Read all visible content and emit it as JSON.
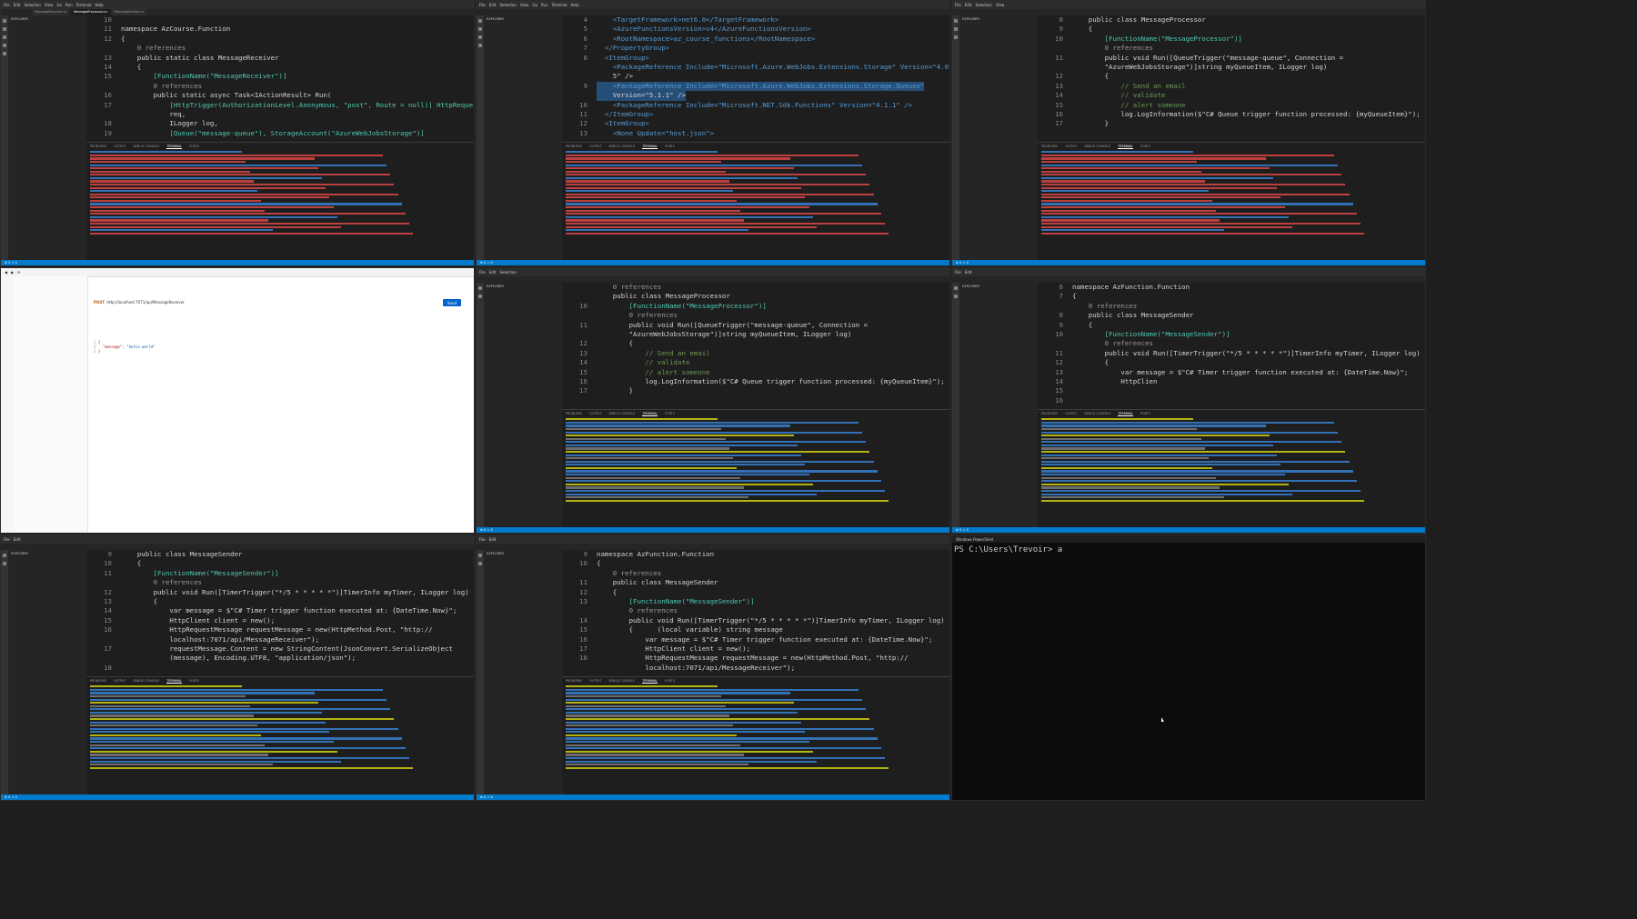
{
  "common": {
    "menu": [
      "File",
      "Edit",
      "Selection",
      "View",
      "Go",
      "Run",
      "Terminal",
      "Help"
    ],
    "explorer_title": "EXPLORER",
    "terminal_tabs": [
      "PROBLEMS",
      "OUTPUT",
      "DEBUG CONSOLE",
      "TERMINAL",
      "PORTS"
    ],
    "status_left": "⊗ 0 ⚠ 0"
  },
  "pane1": {
    "tabs": [
      "MessageReceiver.cs",
      "MessageProcessor.cs",
      "MessageSender.cs"
    ],
    "lines": [
      {
        "n": "10",
        "t": ""
      },
      {
        "n": "11",
        "t": "namespace AzCourse.Function"
      },
      {
        "n": "12",
        "t": "{"
      },
      {
        "n": "",
        "t": "    0 references"
      },
      {
        "n": "13",
        "t": "    public static class MessageReceiver"
      },
      {
        "n": "14",
        "t": "    {"
      },
      {
        "n": "15",
        "t": "        [FunctionName(\"MessageReceiver\")]"
      },
      {
        "n": "",
        "t": "        0 references"
      },
      {
        "n": "16",
        "t": "        public static async Task<IActionResult> Run("
      },
      {
        "n": "17",
        "t": "            [HttpTrigger(AuthorizationLevel.Anonymous, \"post\", Route = null)] HttpRequest"
      },
      {
        "n": "",
        "t": "            req,"
      },
      {
        "n": "18",
        "t": "            ILogger log,"
      },
      {
        "n": "19",
        "t": "            [Queue(\"message-queue\"), StorageAccount(\"AzureWebJobsStorage\")]"
      }
    ]
  },
  "pane2": {
    "lines": [
      {
        "n": "4",
        "t": "    <TargetFramework>net6.0</TargetFramework>"
      },
      {
        "n": "5",
        "t": "    <AzureFunctionsVersion>v4</AzureFunctionsVersion>"
      },
      {
        "n": "6",
        "t": "    <RootNamespace>az_course_functions</RootNamespace>"
      },
      {
        "n": "7",
        "t": "  </PropertyGroup>"
      },
      {
        "n": "8",
        "t": "  <ItemGroup>"
      },
      {
        "n": "",
        "t": "    <PackageReference Include=\"Microsoft.Azure.WebJobs.Extensions.Storage\" Version=\"4.0."
      },
      {
        "n": "",
        "t": "    5\" />"
      },
      {
        "n": "9",
        "t": "    <PackageReference Include=\"Microsoft.Azure.WebJobs.Extensions.Storage.Queues\""
      },
      {
        "n": "",
        "t": "    Version=\"5.1.1\" />"
      },
      {
        "n": "10",
        "t": "    <PackageReference Include=\"Microsoft.NET.Sdk.Functions\" Version=\"4.1.1\" />"
      },
      {
        "n": "11",
        "t": "  </ItemGroup>"
      },
      {
        "n": "12",
        "t": "  <ItemGroup>"
      },
      {
        "n": "13",
        "t": "    <None Update=\"host.json\">"
      }
    ]
  },
  "pane3": {
    "lines": [
      {
        "n": "8",
        "t": "    public class MessageProcessor"
      },
      {
        "n": "9",
        "t": "    {"
      },
      {
        "n": "10",
        "t": "        [FunctionName(\"MessageProcessor\")]"
      },
      {
        "n": "",
        "t": "        0 references"
      },
      {
        "n": "11",
        "t": "        public void Run([QueueTrigger(\"message-queue\", Connection ="
      },
      {
        "n": "",
        "t": "        \"AzureWebJobsStorage\")]string myQueueItem, ILogger log)"
      },
      {
        "n": "12",
        "t": "        {"
      },
      {
        "n": "13",
        "t": "            // Send an email"
      },
      {
        "n": "14",
        "t": "            // validate"
      },
      {
        "n": "15",
        "t": "            // alert someone"
      },
      {
        "n": "16",
        "t": "            log.LogInformation($\"C# Queue trigger function processed: {myQueueItem}\");"
      },
      {
        "n": "17",
        "t": "        }"
      }
    ]
  },
  "pane4": {
    "url": "http://localhost:7071/api/MessageReceiver",
    "method": "POST",
    "send": "Send",
    "body_line1": "{",
    "body_key": "\"message\"",
    "body_value": "\"hello world\"",
    "body_line3": "}"
  },
  "pane5": {
    "lines": [
      {
        "n": "",
        "t": "    0 references"
      },
      {
        "n": "",
        "t": "    public class MessageProcessor"
      },
      {
        "n": "",
        "t": ""
      },
      {
        "n": "10",
        "t": "        [FunctionName(\"MessageProcessor\")]"
      },
      {
        "n": "",
        "t": "        0 references"
      },
      {
        "n": "11",
        "t": "        public void Run([QueueTrigger(\"message-queue\", Connection ="
      },
      {
        "n": "",
        "t": "        \"AzureWebJobsStorage\")]string myQueueItem, ILogger log)"
      },
      {
        "n": "12",
        "t": "        {"
      },
      {
        "n": "13",
        "t": "            // Send an email"
      },
      {
        "n": "14",
        "t": "            // validate"
      },
      {
        "n": "15",
        "t": "            // alert someone"
      },
      {
        "n": "16",
        "t": "            log.LogInformation($\"C# Queue trigger function processed: {myQueueItem}\");"
      },
      {
        "n": "17",
        "t": "        }"
      }
    ]
  },
  "pane6": {
    "lines": [
      {
        "n": "6",
        "t": "namespace AzFunction.Function"
      },
      {
        "n": "7",
        "t": "{"
      },
      {
        "n": "",
        "t": "    0 references"
      },
      {
        "n": "8",
        "t": "    public class MessageSender"
      },
      {
        "n": "9",
        "t": "    {"
      },
      {
        "n": "10",
        "t": "        [FunctionName(\"MessageSender\")]"
      },
      {
        "n": "",
        "t": "        0 references"
      },
      {
        "n": "11",
        "t": "        public void Run([TimerTrigger(\"*/5 * * * * *\")]TimerInfo myTimer, ILogger log)"
      },
      {
        "n": "12",
        "t": "        {"
      },
      {
        "n": "13",
        "t": "            var message = $\"C# Timer trigger function executed at: {DateTime.Now}\";"
      },
      {
        "n": "14",
        "t": "            HttpClien"
      },
      {
        "n": "15",
        "t": ""
      },
      {
        "n": "16",
        "t": ""
      }
    ]
  },
  "pane7": {
    "lines": [
      {
        "n": "9",
        "t": "    public class MessageSender"
      },
      {
        "n": "10",
        "t": "    {"
      },
      {
        "n": "11",
        "t": "        [FunctionName(\"MessageSender\")]"
      },
      {
        "n": "",
        "t": "        0 references"
      },
      {
        "n": "12",
        "t": "        public void Run([TimerTrigger(\"*/5 * * * * *\")]TimerInfo myTimer, ILogger log)"
      },
      {
        "n": "13",
        "t": "        {"
      },
      {
        "n": "14",
        "t": "            var message = $\"C# Timer trigger function executed at: {DateTime.Now}\";"
      },
      {
        "n": "15",
        "t": "            HttpClient client = new();"
      },
      {
        "n": "16",
        "t": "            HttpRequestMessage requestMessage = new(HttpMethod.Post, \"http://"
      },
      {
        "n": "",
        "t": "            localhost:7071/api/MessageReceiver\");"
      },
      {
        "n": "17",
        "t": "            requestMessage.Content = new StringContent(JsonConvert.SerializeObject"
      },
      {
        "n": "",
        "t": "            (message), Encoding.UTF8, \"application/json\");"
      },
      {
        "n": "18",
        "t": ""
      }
    ]
  },
  "pane8": {
    "lines": [
      {
        "n": "9",
        "t": "namespace AzFunction.Function"
      },
      {
        "n": "10",
        "t": "{"
      },
      {
        "n": "",
        "t": "    0 references"
      },
      {
        "n": "11",
        "t": "    public class MessageSender"
      },
      {
        "n": "12",
        "t": "    {"
      },
      {
        "n": "13",
        "t": "        [FunctionName(\"MessageSender\")]"
      },
      {
        "n": "",
        "t": "        0 references"
      },
      {
        "n": "14",
        "t": "        public void Run([TimerTrigger(\"*/5 * * * * *\")]TimerInfo myTimer, ILogger log)"
      },
      {
        "n": "15",
        "t": "        {      (local variable) string message"
      },
      {
        "n": "16",
        "t": "            var message = $\"C# Timer trigger function executed at: {DateTime.Now}\";"
      },
      {
        "n": "17",
        "t": "            HttpClient client = new();"
      },
      {
        "n": "18",
        "t": "            HttpRequestMessage requestMessage = new(HttpMethod.Post, \"http://"
      },
      {
        "n": "",
        "t": "            localhost:7071/api/MessageReceiver\");"
      }
    ]
  },
  "pane9": {
    "title": "Windows PowerShell",
    "prompt": "PS C:\\Users\\Trevoir> a"
  },
  "colors": {
    "accent": "#007acc",
    "editor_bg": "#1e1e1e",
    "sidebar_bg": "#252526",
    "send_button": "#0265d2"
  }
}
